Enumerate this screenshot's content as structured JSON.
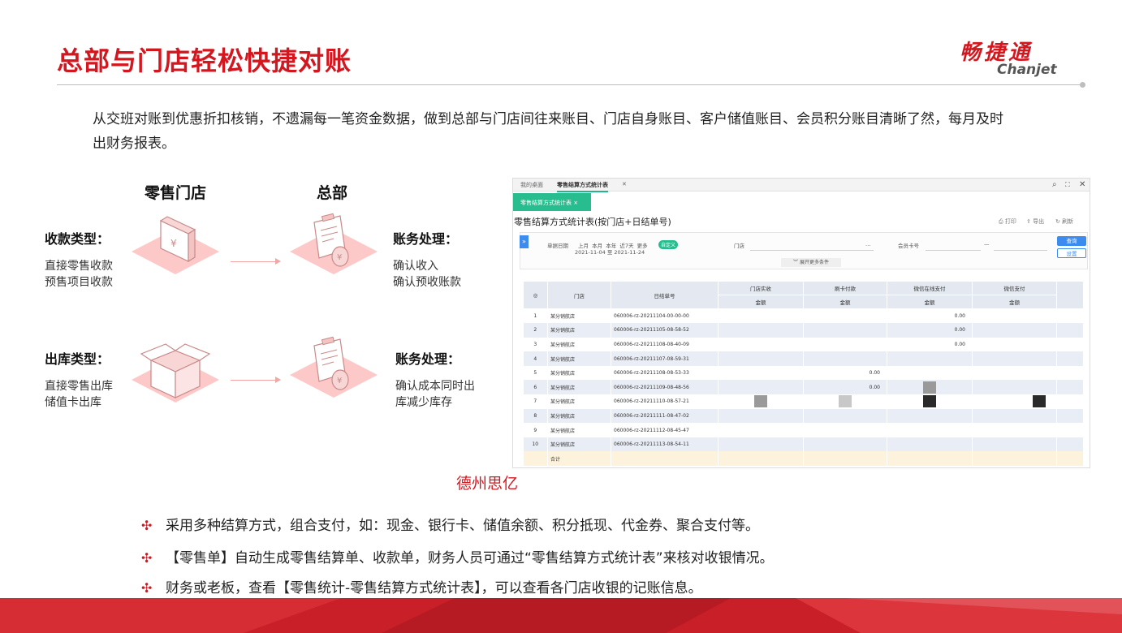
{
  "header": {
    "title": "总部与门店轻松快捷对账",
    "logo_cn": "畅捷通",
    "logo_en": "Chanjet"
  },
  "intro": "从交班对账到优惠折扣核销，不遗漏每一笔资金数据，做到总部与门店间往来账目、门店自身账目、客户储值账目、会员积分账目清晰了然，每月及时出财务报表。",
  "flow": {
    "store_heading": "零售门店",
    "hq_heading": "总部",
    "row1": {
      "left_label": "收款类型：",
      "left_text": "直接零售收款\n预售项目收款",
      "right_label": "账务处理：",
      "right_text": "确认收入\n确认预收账款"
    },
    "row2": {
      "left_label": "出库类型：",
      "left_text": "直接零售出库\n储值卡出库",
      "right_label": "账务处理：",
      "right_text": "确认成本同时出\n库减少库存"
    }
  },
  "screenshot": {
    "tabs": [
      "我的桌面",
      "零售结算方式统计表"
    ],
    "subtab": "零售结算方式统计表 ×",
    "window_icons": [
      "search-icon",
      "fullscreen-icon",
      "close-icon"
    ],
    "report_title": "零售结算方式统计表(按门店+日结单号)",
    "tools": [
      "打印",
      "导出",
      "刷新"
    ],
    "filter": {
      "date_label": "单据日期",
      "quick_ranges": "上月  本月  本年  近7天  更多",
      "custom_tag": "自定义",
      "date_range": "2021-11-04 至 2021-11-24",
      "store_label": "门店",
      "store_ellipsis": "…",
      "member_label": "会员卡号",
      "dash": "—",
      "query_btn": "查询",
      "setting_btn": "设置",
      "more_conditions": "展开更多条件"
    },
    "table": {
      "headers": [
        "序",
        "门店",
        "日结单号",
        "门店实收",
        "刷卡付款",
        "微信在线支付",
        "微信支付"
      ],
      "sub_header": "金额",
      "rows": [
        {
          "no": "1",
          "store": "某分销航店",
          "code": "060006-rz-20211104-00-00-00",
          "v3": "0.00",
          "v1": "",
          "v2": ""
        },
        {
          "no": "2",
          "store": "某分销航店",
          "code": "060006-rz-20211105-08-58-52",
          "v3": "0.00",
          "v1": "",
          "v2": ""
        },
        {
          "no": "3",
          "store": "某分销航店",
          "code": "060006-rz-20211108-08-40-09",
          "v3": "0.00",
          "v1": "",
          "v2": ""
        },
        {
          "no": "4",
          "store": "某分销航店",
          "code": "060006-rz-20211107-08-59-31",
          "v3": "",
          "v1": "",
          "v2": ""
        },
        {
          "no": "5",
          "store": "某分销航店",
          "code": "060006-rz-20211108-08-53-33",
          "v3": "",
          "v1": "",
          "v2": "0.00"
        },
        {
          "no": "6",
          "store": "某分销航店",
          "code": "060006-rz-20211109-08-48-56",
          "v3": "",
          "v1": "",
          "v2": "0.00"
        },
        {
          "no": "7",
          "store": "某分销航店",
          "code": "060006-rz-20211110-08-57-21",
          "v3": "",
          "v1": "",
          "v2": ""
        },
        {
          "no": "8",
          "store": "某分销航店",
          "code": "060006-rz-20211111-08-47-02",
          "v3": "",
          "v1": "",
          "v2": ""
        },
        {
          "no": "9",
          "store": "某分销航店",
          "code": "060006-rz-20211112-08-45-47",
          "v3": "",
          "v1": "",
          "v2": ""
        },
        {
          "no": "10",
          "store": "某分销航店",
          "code": "060006-rz-20211113-08-54-11",
          "v3": "",
          "v1": "",
          "v2": ""
        }
      ],
      "total_label": "合计"
    }
  },
  "caption": "德州思亿",
  "bullets": [
    "采用多种结算方式，组合支付，如：现金、银行卡、储值余额、积分抵现、代金券、聚合支付等。",
    "【零售单】自动生成零售结算单、收款单，财务人员可通过“零售结算方式统计表”来核对收银情况。",
    "财务或老板，查看【零售统计-零售结算方式统计表】，可以查看各门店收银的记账信息。"
  ],
  "bullet_icon": "clover-icon",
  "colors": {
    "brand_red": "#d4161f",
    "accent_green": "#27bd8e",
    "icon_pink": "#fbb7b5"
  }
}
